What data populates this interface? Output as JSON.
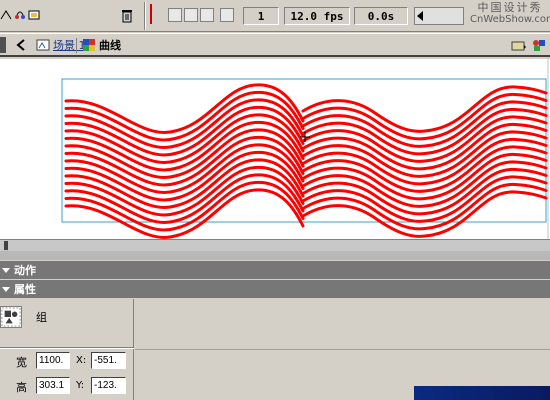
{
  "timeline": {
    "frame_number": "1",
    "frame_rate": "12.0 fps",
    "elapsed_time": "0.0s"
  },
  "watermark": {
    "line1": "中国设计秀",
    "line2": "CnWebShow.com"
  },
  "breadcrumb": {
    "scene_label": "场景 1",
    "symbol_label": "曲线"
  },
  "panels": {
    "actions_title": "动作",
    "properties_title": "属性"
  },
  "properties": {
    "type_label": "组",
    "width_label": "宽",
    "width_value": "1100.",
    "height_label": "高",
    "height_value": "303.1",
    "x_label": "X:",
    "x_value": "-551.",
    "y_label": "Y:",
    "y_value": "-123."
  },
  "colors": {
    "stroke": "#ff0000",
    "selection_box": "#33a6cc",
    "panel_header": "#777777"
  }
}
